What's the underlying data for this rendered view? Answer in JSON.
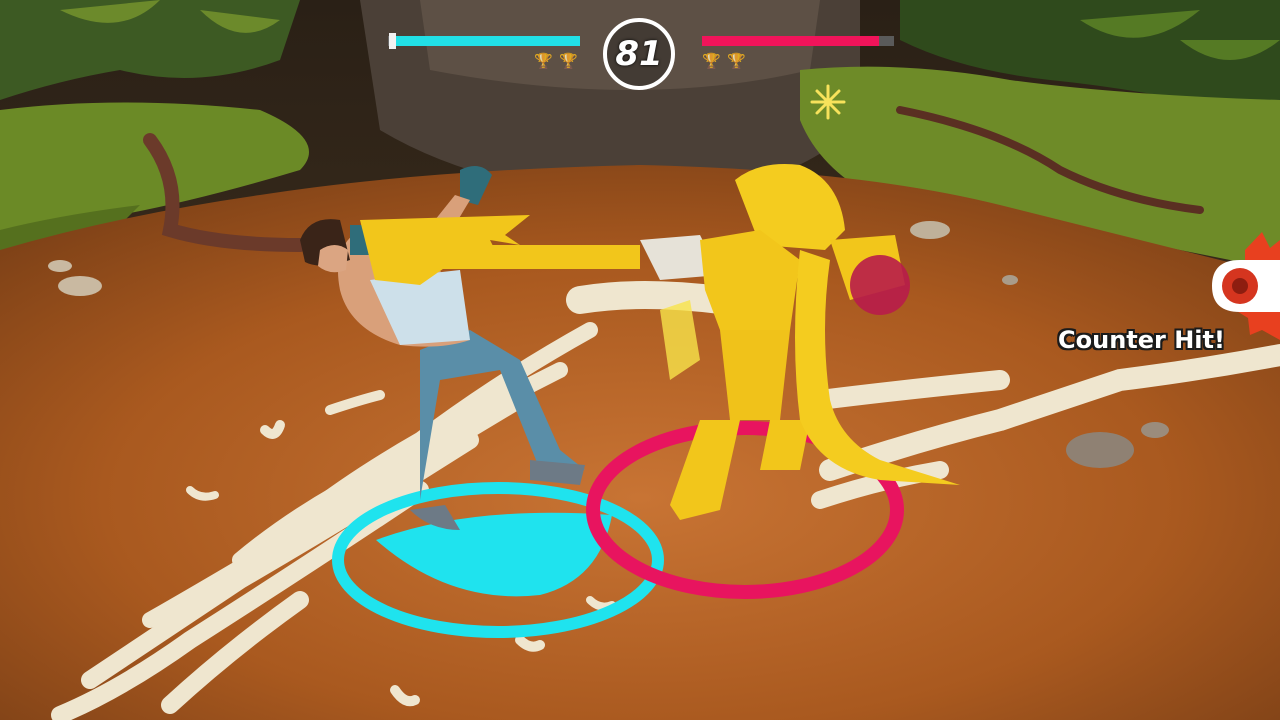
{
  "hud": {
    "timer": "81",
    "player1": {
      "health": 0.98,
      "bar_color": "#22e0e6",
      "trophies": [
        "trophy-icon",
        "trophy-icon"
      ]
    },
    "player2": {
      "health": 0.92,
      "bar_color": "#f0145a",
      "trophies": [
        "trophy-icon",
        "trophy-icon"
      ]
    }
  },
  "combat_text": "Counter Hit!",
  "colors": {
    "player1_ring": "#1fe3ee",
    "player2_ring": "#e8145f",
    "ground": "#b8642a",
    "grass": "#6f8a2a",
    "bone": "#efe6cf",
    "robot_yellow": "#f2c61b"
  }
}
